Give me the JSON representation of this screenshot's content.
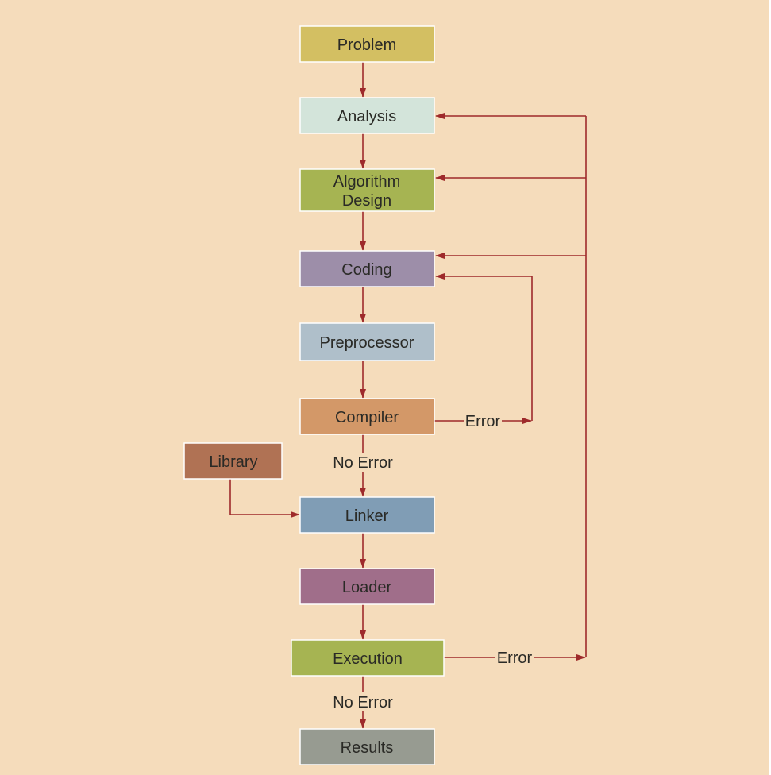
{
  "colors": {
    "background": "#f5dcbb",
    "arrow": "#9e2a2b"
  },
  "nodes": {
    "problem": {
      "label": "Problem",
      "color": "#d3bf62"
    },
    "analysis": {
      "label": "Analysis",
      "color": "#d3e4da"
    },
    "algorithm_design": {
      "label1": "Algorithm",
      "label2": "Design",
      "color": "#a6b452"
    },
    "coding": {
      "label": "Coding",
      "color": "#9d8ea9"
    },
    "preprocessor": {
      "label": "Preprocessor",
      "color": "#afbfca"
    },
    "compiler": {
      "label": "Compiler",
      "color": "#d39868"
    },
    "library": {
      "label": "Library",
      "color": "#b07254"
    },
    "linker": {
      "label": "Linker",
      "color": "#809db5"
    },
    "loader": {
      "label": "Loader",
      "color": "#a06e8a"
    },
    "execution": {
      "label": "Execution",
      "color": "#a6b452"
    },
    "results": {
      "label": "Results",
      "color": "#979b91"
    }
  },
  "edge_labels": {
    "compiler_error": "Error",
    "compiler_no_error": "No Error",
    "execution_error": "Error",
    "execution_no_error": "No Error"
  }
}
